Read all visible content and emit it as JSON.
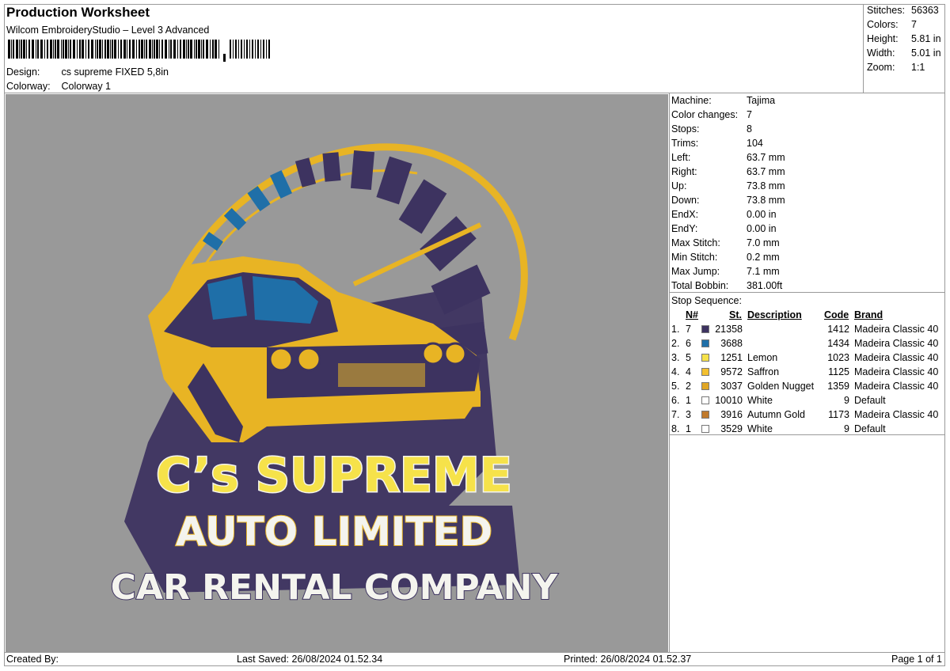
{
  "header": {
    "title": "Production Worksheet",
    "software": "Wilcom EmbroideryStudio – Level 3 Advanced",
    "design_label": "Design:",
    "design_value": "cs supreme FIXED 5,8in",
    "colorway_label": "Colorway:",
    "colorway_value": "Colorway 1"
  },
  "stats": [
    {
      "label": "Stitches:",
      "value": "56363"
    },
    {
      "label": "Colors:",
      "value": "7"
    },
    {
      "label": "Height:",
      "value": "5.81 in"
    },
    {
      "label": "Width:",
      "value": "5.01 in"
    },
    {
      "label": "Zoom:",
      "value": "1:1"
    }
  ],
  "machine_info": [
    {
      "label": "Machine:",
      "value": "Tajima"
    },
    {
      "label": "Color changes:",
      "value": "7"
    },
    {
      "label": "Stops:",
      "value": "8"
    },
    {
      "label": "Trims:",
      "value": "104"
    },
    {
      "label": "Left:",
      "value": "63.7 mm"
    },
    {
      "label": "Right:",
      "value": "63.7 mm"
    },
    {
      "label": "Up:",
      "value": "73.8 mm"
    },
    {
      "label": "Down:",
      "value": "73.8 mm"
    },
    {
      "label": "EndX:",
      "value": "0.00 in"
    },
    {
      "label": "EndY:",
      "value": "0.00 in"
    },
    {
      "label": "Max Stitch:",
      "value": "7.0 mm"
    },
    {
      "label": "Min Stitch:",
      "value": "0.2 mm"
    },
    {
      "label": "Max Jump:",
      "value": "7.1 mm"
    },
    {
      "label": "Total Bobbin:",
      "value": "381.00ft"
    }
  ],
  "stop_sequence": {
    "label": "Stop Sequence:",
    "columns": {
      "n": "N#",
      "st": "St.",
      "description": "Description",
      "code": "Code",
      "brand": "Brand"
    },
    "rows": [
      {
        "idx": "1.",
        "n": "7",
        "color": "#3d3360",
        "st": "21358",
        "description": "",
        "code": "1412",
        "brand": "Madeira Classic 40"
      },
      {
        "idx": "2.",
        "n": "6",
        "color": "#1f6fa8",
        "st": "3688",
        "description": "",
        "code": "1434",
        "brand": "Madeira Classic 40"
      },
      {
        "idx": "3.",
        "n": "5",
        "color": "#f6e24a",
        "st": "1251",
        "description": "Lemon",
        "code": "1023",
        "brand": "Madeira Classic 40"
      },
      {
        "idx": "4.",
        "n": "4",
        "color": "#f3c02f",
        "st": "9572",
        "description": "Saffron",
        "code": "1125",
        "brand": "Madeira Classic 40"
      },
      {
        "idx": "5.",
        "n": "2",
        "color": "#e0a624",
        "st": "3037",
        "description": "Golden Nugget",
        "code": "1359",
        "brand": "Madeira Classic 40"
      },
      {
        "idx": "6.",
        "n": "1",
        "color": "#ffffff",
        "st": "10010",
        "description": "White",
        "code": "9",
        "brand": "Default"
      },
      {
        "idx": "7.",
        "n": "3",
        "color": "#c07a2c",
        "st": "3916",
        "description": "Autumn Gold",
        "code": "1173",
        "brand": "Madeira Classic 40"
      },
      {
        "idx": "8.",
        "n": "1",
        "color": "#ffffff",
        "st": "3529",
        "description": "White",
        "code": "9",
        "brand": "Default"
      }
    ]
  },
  "design_text": {
    "line1": "C’s SUPREME",
    "line2": "AUTO LIMITED",
    "line3": "CAR RENTAL COMPANY"
  },
  "footer": {
    "created_by": "Created By:",
    "last_saved": "Last Saved: 26/08/2024 01.52.34",
    "printed": "Printed: 26/08/2024 01.52.37",
    "page": "Page 1 of 1"
  },
  "colors": {
    "canvas": "#999999",
    "purple": "#3d3360",
    "gold": "#e8b424",
    "yellow": "#f6e24a",
    "blue": "#1f6fa8",
    "white": "#f4f4ee"
  }
}
